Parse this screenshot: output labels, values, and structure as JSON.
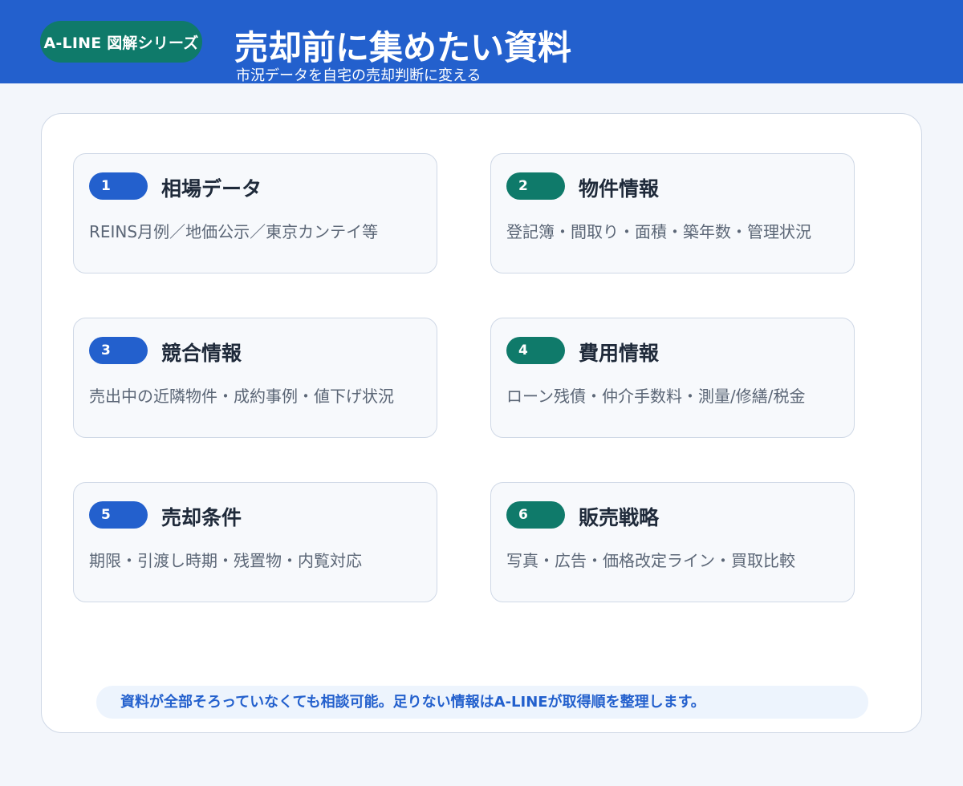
{
  "header": {
    "brand": "A-LINE 図解シリーズ",
    "title": "売却前に集めたい資料",
    "subtitle": "市況データを自宅の売却判断に変える"
  },
  "cards": [
    {
      "number": "1",
      "title": "相場データ",
      "description": "REINS月例／地価公示／東京カンテイ等"
    },
    {
      "number": "2",
      "title": "物件情報",
      "description": "登記簿・間取り・面積・築年数・管理状況"
    },
    {
      "number": "3",
      "title": "競合情報",
      "description": "売出中の近隣物件・成約事例・値下げ状況"
    },
    {
      "number": "4",
      "title": "費用情報",
      "description": "ローン残債・仲介手数料・測量/修繕/税金"
    },
    {
      "number": "5",
      "title": "売却条件",
      "description": "期限・引渡し時期・残置物・内覧対応"
    },
    {
      "number": "6",
      "title": "販売戦略",
      "description": "写真・広告・価格改定ライン・買取比較"
    }
  ],
  "note": "資料が全部そろっていなくても相談可能。足りない情報はA-LINEが取得順を整理します。",
  "colors": {
    "header": "#2360cd",
    "accent_blue": "#2360cd",
    "accent_green": "#0f7a6a"
  }
}
